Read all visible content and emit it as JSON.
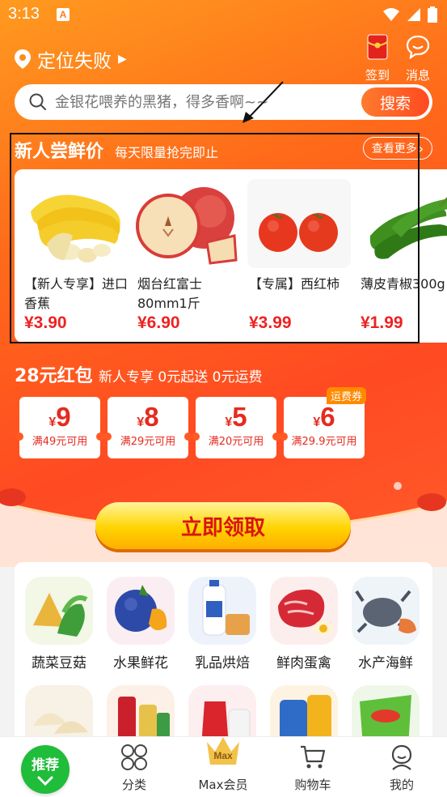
{
  "status_bar": {
    "time": "3:13",
    "app_badge": "A"
  },
  "header": {
    "location": "定位失败",
    "checkin_label": "签到",
    "message_label": "消息"
  },
  "search": {
    "placeholder": "金银花喂养的黑猪，得多香啊~~",
    "button_label": "搜索"
  },
  "new_user_deals": {
    "title": "新人尝鲜价",
    "subtitle": "每天限量抢完即止",
    "view_more_label": "查看更多",
    "items": [
      {
        "name": "【新人专享】进口香蕉",
        "price": "¥3.90",
        "icon": "banana-image"
      },
      {
        "name": "烟台红富士80mm1斤",
        "price": "¥6.90",
        "icon": "apple-image"
      },
      {
        "name": "【专属】西红柿",
        "price": "¥3.99",
        "icon": "tomato-image"
      },
      {
        "name": "薄皮青椒300g",
        "price": "¥1.99",
        "icon": "green-pepper-image"
      }
    ]
  },
  "red_packet": {
    "title": "28元红包",
    "subtitle": "新人专享 0元起送 0元运费",
    "coupons": [
      {
        "currency": "¥",
        "amount": "9",
        "condition": "满49元可用",
        "badge": ""
      },
      {
        "currency": "¥",
        "amount": "8",
        "condition": "满29元可用",
        "badge": ""
      },
      {
        "currency": "¥",
        "amount": "5",
        "condition": "满20元可用",
        "badge": ""
      },
      {
        "currency": "¥",
        "amount": "6",
        "condition": "满29.9元可用",
        "badge": "运费券"
      }
    ],
    "claim_label": "立即领取"
  },
  "categories": [
    {
      "label": "蔬菜豆菇",
      "icon": "vegetables-image"
    },
    {
      "label": "水果鲜花",
      "icon": "fruits-image"
    },
    {
      "label": "乳品烘焙",
      "icon": "dairy-image"
    },
    {
      "label": "鲜肉蛋禽",
      "icon": "meat-image"
    },
    {
      "label": "水产海鲜",
      "icon": "seafood-image"
    }
  ],
  "tabbar": {
    "home": "推荐",
    "category": "分类",
    "max": "Max会员",
    "max_badge": "Max",
    "cart": "购物车",
    "mine": "我的"
  },
  "colors": {
    "accent_orange": "#ff6a1a",
    "price_red": "#ee2222",
    "home_green": "#1fbd3a",
    "claim_yellow": "#ffd400"
  }
}
